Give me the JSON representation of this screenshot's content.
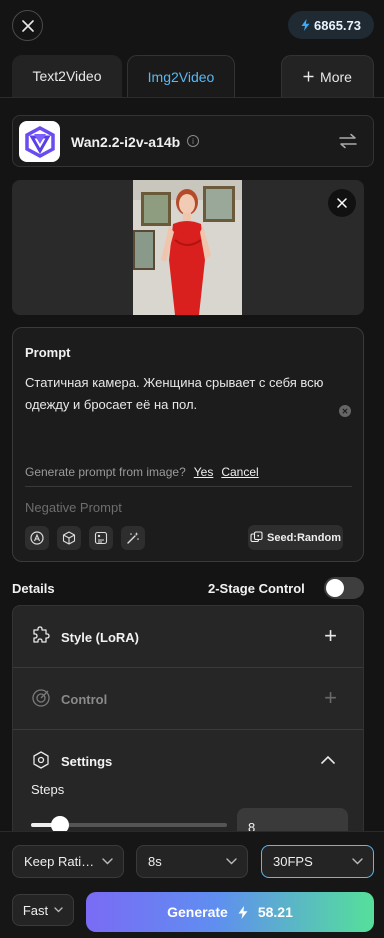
{
  "header": {
    "credits": "6865.73"
  },
  "tabs": {
    "text2video": "Text2Video",
    "img2video": "Img2Video",
    "more": "More"
  },
  "model": {
    "name": "Wan2.2-i2v-a14b",
    "info": "i"
  },
  "prompt": {
    "label": "Prompt",
    "text": "Статичная камера. Женщина срывает с себя всю одежду и бросает её на пол.",
    "generate_question": "Generate prompt from image?",
    "yes": "Yes",
    "cancel": "Cancel",
    "negative_placeholder": "Negative Prompt",
    "seed": "Seed:Random"
  },
  "details": {
    "label": "Details",
    "two_stage_label": "2-Stage Control",
    "two_stage_on": false
  },
  "accordion": {
    "style": "Style (LoRA)",
    "control": "Control",
    "settings": "Settings",
    "steps_label": "Steps",
    "steps_value": "8",
    "steps_slider_fraction": 0.15
  },
  "footer": {
    "aspect": "Keep Rati…",
    "duration": "8s",
    "fps": "30FPS",
    "speed": "Fast",
    "generate_label": "Generate",
    "generate_cost": "58.21"
  },
  "colors": {
    "accent": "#5bb8f0",
    "gradient_start": "#7a6bf5",
    "gradient_end": "#55e09a"
  }
}
